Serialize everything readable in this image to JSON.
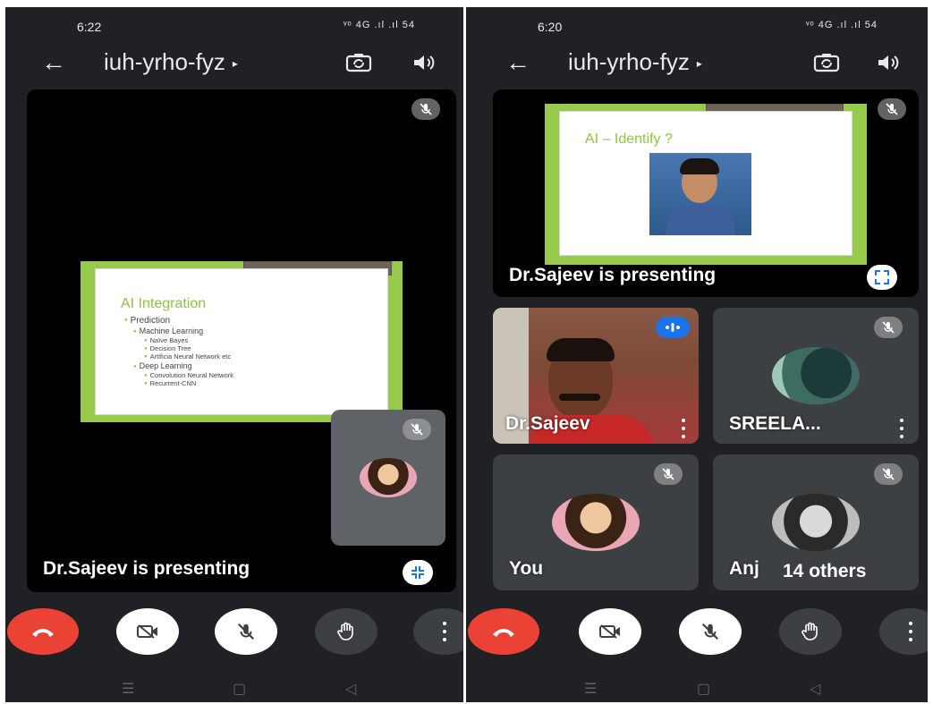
{
  "left": {
    "status": {
      "time": "6:22",
      "icons": "ᵛᵒ 4G .ıl .ıl 54"
    },
    "topbar": {
      "title": "iuh-yrho-fyz",
      "caret": "▸"
    },
    "slide": {
      "title": "AI Integration",
      "bullets": [
        {
          "level": 1,
          "text": "Prediction"
        },
        {
          "level": 2,
          "text": "Machine Learning"
        },
        {
          "level": 3,
          "text": "Naïve Bayes"
        },
        {
          "level": 3,
          "text": "Decision Tree"
        },
        {
          "level": 3,
          "text": "Artificia Neural Network etc"
        },
        {
          "level": 2,
          "text": "Deep Learning"
        },
        {
          "level": 3,
          "text": "Convolution Neural Network"
        },
        {
          "level": 3,
          "text": "Recurrent-CNN"
        }
      ]
    },
    "presenting_label": "Dr.Sajeev is presenting"
  },
  "right": {
    "status": {
      "time": "6:20",
      "icons": "ᵛᵒ 4G .ıl .ıl 54"
    },
    "topbar": {
      "title": "iuh-yrho-fyz",
      "caret": "▸"
    },
    "slide": {
      "title": "AI – Identify ?"
    },
    "presenting_label": "Dr.Sajeev is presenting",
    "tiles": [
      {
        "name": "Dr.Sajeev"
      },
      {
        "name": "SREELA..."
      },
      {
        "name": "You"
      },
      {
        "name": "Anj"
      }
    ],
    "others_label": "14 others"
  },
  "icons": {
    "back": "←",
    "nav_recent": "☰",
    "nav_home": "▢",
    "nav_back": "◁"
  },
  "colors": {
    "background": "#202124",
    "end_call": "#ea4335",
    "slide_frame": "#97c94a",
    "slide_title": "#8dc63f",
    "speaking_badge": "#1a73e8"
  }
}
